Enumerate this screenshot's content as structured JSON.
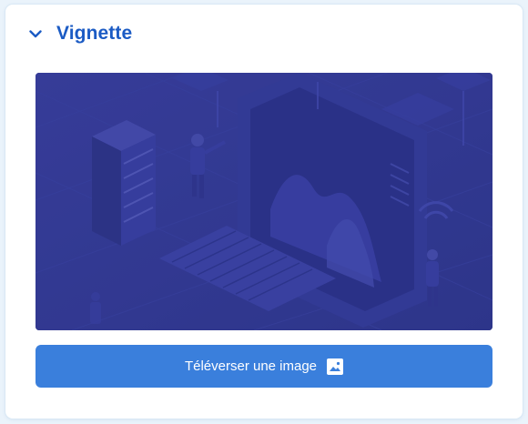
{
  "panel": {
    "title": "Vignette",
    "collapse_icon": "chevron-down-icon",
    "accent_color": "#1b5bc4"
  },
  "thumbnail": {
    "image": "isometric-tech-illustration",
    "tint_color": "#323a8f"
  },
  "upload_button": {
    "label": "Téléverser une image",
    "icon": "image-icon",
    "color": "#3a7fdc"
  }
}
